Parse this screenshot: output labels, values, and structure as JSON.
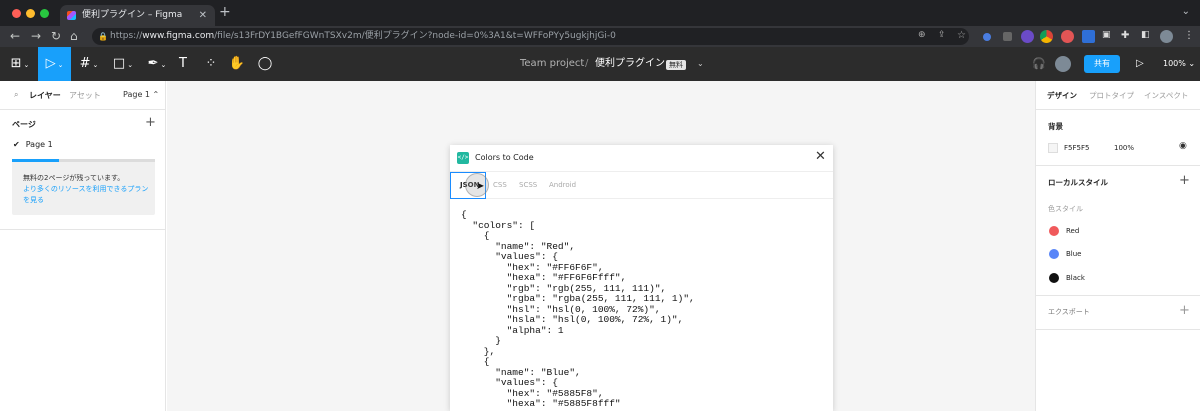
{
  "browser": {
    "tab_title": "便利プラグイン – Figma",
    "tab_close": "✕",
    "new_tab": "+",
    "tab_menu": "⌄",
    "url_scheme": "https://",
    "url_host": "www.figma.com",
    "url_path": "/file/s13FrDY1BGefFGWnTSXv2m/便利プラグイン?node-id=0%3A1&t=WFFoPYy5ugkjhjGi-0",
    "colors": {
      "red": "#ff5f57",
      "yellow": "#febc2e",
      "green": "#28c840"
    }
  },
  "toolbar": {
    "project": "Team project",
    "separator": "/",
    "file_name": "便利プラグイン",
    "free_badge": "無料",
    "share_label": "共有",
    "zoom_label": "100%",
    "accent": "#18a0fb"
  },
  "left_panel": {
    "tabs": [
      "レイヤー",
      "アセット",
      "Page 1 ⌃"
    ],
    "pages_heading": "ページ",
    "current_page": "Page 1",
    "upsell_text": "無料の2ページが残っています。",
    "upsell_link": "より多くのリソースを利用できるプランを見る",
    "pages_used_fraction": 0.33
  },
  "plugin": {
    "title": "Colors to Code",
    "tabs": [
      "JSON",
      "CSS",
      "SCSS",
      "Android"
    ],
    "active_tab": "JSON",
    "code": "{\n  \"colors\": [\n    {\n      \"name\": \"Red\",\n      \"values\": {\n        \"hex\": \"#FF6F6F\",\n        \"hexa\": \"#FF6F6Ffff\",\n        \"rgb\": \"rgb(255, 111, 111)\",\n        \"rgba\": \"rgba(255, 111, 111, 1)\",\n        \"hsl\": \"hsl(0, 100%, 72%)\",\n        \"hsla\": \"hsl(0, 100%, 72%, 1)\",\n        \"alpha\": 1\n      }\n    },\n    {\n      \"name\": \"Blue\",\n      \"values\": {\n        \"hex\": \"#5885F8\",\n        \"hexa\": \"#5885F8fff\""
  },
  "right_panel": {
    "tabs": [
      "デザイン",
      "プロトタイプ",
      "インスペクト"
    ],
    "background_heading": "背景",
    "background_hex": "F5F5F5",
    "background_opacity": "100%",
    "background_color": "#f5f5f5",
    "local_styles_heading": "ローカルスタイル",
    "color_styles_label": "色スタイル",
    "styles": [
      {
        "name": "Red",
        "color": "#f0595b"
      },
      {
        "name": "Blue",
        "color": "#5885f8"
      },
      {
        "name": "Black",
        "color": "#111111"
      }
    ],
    "export_heading": "エクスポート"
  }
}
